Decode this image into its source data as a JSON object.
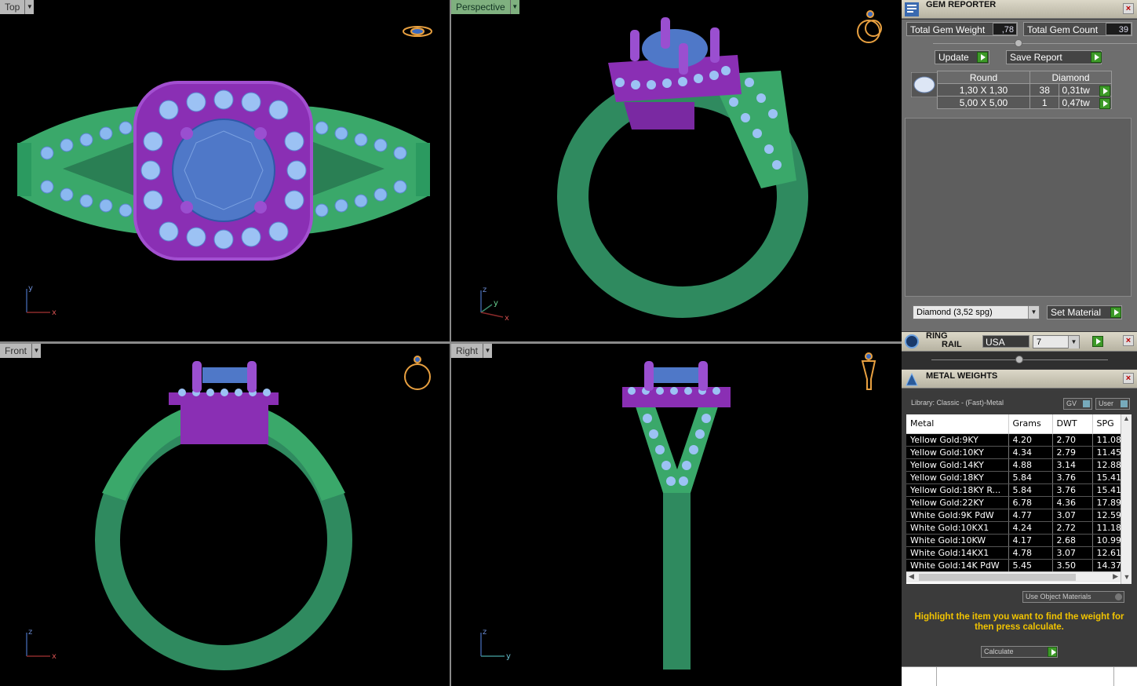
{
  "viewports": {
    "top": {
      "label": "Top",
      "axis1": "y",
      "axis2": "x"
    },
    "perspective": {
      "label": "Perspective",
      "axis1": "z",
      "axis2": "y",
      "axis3": "x"
    },
    "front": {
      "label": "Front",
      "axis1": "z",
      "axis2": "x"
    },
    "right": {
      "label": "Right",
      "axis1": "z",
      "axis2": "y"
    }
  },
  "gem_reporter": {
    "title": "GEM REPORTER",
    "total_weight_label": "Total Gem Weight",
    "total_weight_value": ",78",
    "total_count_label": "Total Gem Count",
    "total_count_value": "39",
    "update_label": "Update",
    "save_report_label": "Save Report",
    "table": {
      "col1": "Round",
      "col2": "Diamond",
      "rows": [
        {
          "size": "1,30 X 1,30",
          "count": "38",
          "weight": "0,31tw"
        },
        {
          "size": "5,00 X 5,00",
          "count": "1",
          "weight": "0,47tw"
        }
      ]
    },
    "material_select": "Diamond     (3,52 spg)",
    "set_material_label": "Set Material"
  },
  "ring_rail": {
    "title_line1": "RING",
    "title_line2": "RAIL",
    "country": "USA",
    "size": "7"
  },
  "metal_weights": {
    "title": "METAL WEIGHTS",
    "library": "Library: Classic - (Fast)-Metal",
    "gv_label": "GV",
    "user_label": "User",
    "columns": [
      "Metal",
      "Grams",
      "DWT",
      "SPG"
    ],
    "rows": [
      [
        "Yellow Gold:9KY",
        "4.20",
        "2.70",
        "11.08"
      ],
      [
        "Yellow Gold:10KY",
        "4.34",
        "2.79",
        "11.45"
      ],
      [
        "Yellow Gold:14KY",
        "4.88",
        "3.14",
        "12.88"
      ],
      [
        "Yellow Gold:18KY",
        "5.84",
        "3.76",
        "15.41"
      ],
      [
        "Yellow Gold:18KY R...",
        "5.84",
        "3.76",
        "15.41"
      ],
      [
        "Yellow Gold:22KY",
        "6.78",
        "4.36",
        "17.89"
      ],
      [
        "White Gold:9K PdW",
        "4.77",
        "3.07",
        "12.59"
      ],
      [
        "White Gold:10KX1",
        "4.24",
        "2.72",
        "11.18"
      ],
      [
        "White Gold:10KW",
        "4.17",
        "2.68",
        "10.99"
      ],
      [
        "White Gold:14KX1",
        "4.78",
        "3.07",
        "12.61"
      ],
      [
        "White Gold:14K PdW",
        "5.45",
        "3.50",
        "14.37"
      ]
    ],
    "use_object_materials": "Use Object Materials",
    "hint": "Highlight the item you want to find the weight for then press calculate.",
    "calculate_label": "Calculate"
  },
  "colors": {
    "metal_green": "#2f8a5f",
    "prong_purple": "#8a2fb4",
    "stone_blue": "#4f78c8",
    "accent_light_blue": "#9cc2f4"
  }
}
